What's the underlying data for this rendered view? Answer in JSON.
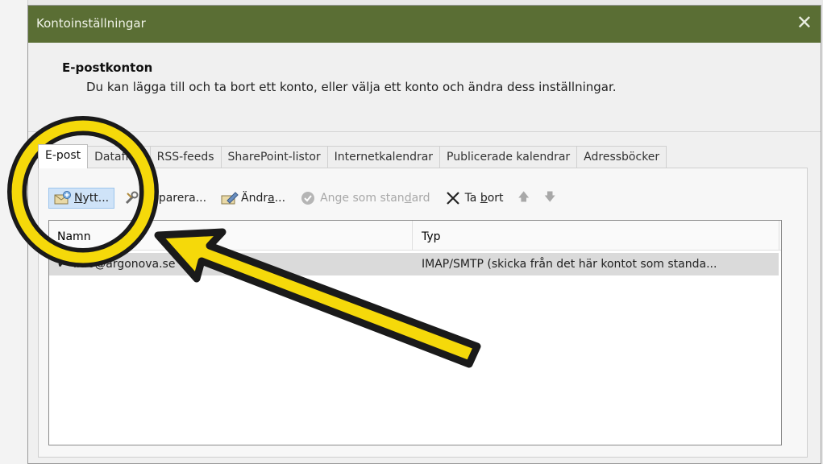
{
  "dialog": {
    "title": "Kontoinställningar",
    "close_glyph": "✕",
    "section_title": "E-postkonton",
    "section_desc": "Du kan lägga till och ta bort ett konto, eller välja ett konto och ändra dess inställningar."
  },
  "tabs": [
    {
      "label": "E-post",
      "active": true
    },
    {
      "label": "Datafiler",
      "active": false
    },
    {
      "label": "RSS-feeds",
      "active": false
    },
    {
      "label": "SharePoint-listor",
      "active": false
    },
    {
      "label": "Internetkalendrar",
      "active": false
    },
    {
      "label": "Publicerade kalendrar",
      "active": false
    },
    {
      "label": "Adressböcker",
      "active": false
    }
  ],
  "toolbar": {
    "new_pre": "",
    "new_u": "N",
    "new_post": "ytt...",
    "repair_pre": "",
    "repair_u": "R",
    "repair_post": "eparera...",
    "change_pre": "Ändr",
    "change_u": "a",
    "change_post": "...",
    "default_pre": "Ange som stan",
    "default_u": "d",
    "default_post": "ard",
    "remove_pre": "Ta ",
    "remove_u": "b",
    "remove_post": "ort",
    "up_glyph": "🡅",
    "down_glyph": "🡇"
  },
  "list": {
    "col_name": "Namn",
    "col_type": "Typ",
    "rows": [
      {
        "check": "✔",
        "name": "info@argonova.se",
        "type": "IMAP/SMTP (skicka från det här kontot som standa..."
      }
    ]
  },
  "colors": {
    "titlebar": "#5a6e34",
    "annotation": "#f5d90a",
    "annotation_outline": "#1a1a1a"
  }
}
